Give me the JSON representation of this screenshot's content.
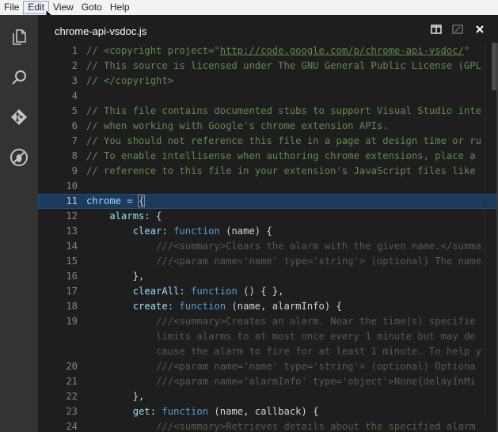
{
  "menu": [
    "File",
    "Edit",
    "View",
    "Goto",
    "Help"
  ],
  "tab": {
    "title": "chrome-api-vsdoc.js"
  },
  "activity": [
    "files-icon",
    "search-icon",
    "git-icon",
    "debug-icon"
  ],
  "titlebar_buttons": [
    "split-editor-icon",
    "open-changes-icon",
    "close-icon"
  ],
  "lines": [
    {
      "n": "1",
      "segments": [
        {
          "t": "// <copyright project=\"",
          "c": "comment"
        },
        {
          "t": "http://code.google.com/p/chrome-api-vsdoc/",
          "c": "comment link"
        },
        {
          "t": "\" ",
          "c": "comment"
        }
      ]
    },
    {
      "n": "2",
      "segments": [
        {
          "t": "// This source is licensed under The GNU General Public License (GPL",
          "c": "comment"
        }
      ]
    },
    {
      "n": "3",
      "segments": [
        {
          "t": "// </copyright>",
          "c": "comment"
        }
      ]
    },
    {
      "n": "4",
      "segments": []
    },
    {
      "n": "5",
      "segments": [
        {
          "t": "// This file contains documented stubs to support Visual Studio inte",
          "c": "comment"
        }
      ]
    },
    {
      "n": "6",
      "segments": [
        {
          "t": "// when working with Google's chrome extension APIs.",
          "c": "comment"
        }
      ]
    },
    {
      "n": "7",
      "segments": [
        {
          "t": "// You should not reference this file in a page at design time or ru",
          "c": "comment"
        }
      ]
    },
    {
      "n": "8",
      "segments": [
        {
          "t": "// To enable intellisense when authoring chrome extensions, place a ",
          "c": "comment"
        }
      ]
    },
    {
      "n": "9",
      "segments": [
        {
          "t": "// reference to this file in your extension's JavaScript files like",
          "c": "comment"
        }
      ]
    },
    {
      "n": "10",
      "segments": []
    },
    {
      "n": "11",
      "highlight": true,
      "segments": [
        {
          "t": "chrome = ",
          "c": "prop"
        },
        {
          "t": "{",
          "c": "bracket"
        }
      ]
    },
    {
      "n": "12",
      "segments": [
        {
          "t": "    alarms: {",
          "c": "prop"
        }
      ]
    },
    {
      "n": "13",
      "segments": [
        {
          "t": "        clear: ",
          "c": "prop"
        },
        {
          "t": "function",
          "c": "kw"
        },
        {
          "t": " (name) {",
          "c": ""
        }
      ]
    },
    {
      "n": "14",
      "segments": [
        {
          "t": "            ",
          "c": ""
        },
        {
          "t": "///<summary>Clears the alarm with the given name.</summa",
          "c": "comment-dim"
        }
      ]
    },
    {
      "n": "15",
      "segments": [
        {
          "t": "            ",
          "c": ""
        },
        {
          "t": "///<param name='name' type='string'> (optional) The name",
          "c": "comment-dim"
        }
      ]
    },
    {
      "n": "16",
      "segments": [
        {
          "t": "        },",
          "c": ""
        }
      ]
    },
    {
      "n": "17",
      "segments": [
        {
          "t": "        clearAll: ",
          "c": "prop"
        },
        {
          "t": "function",
          "c": "kw"
        },
        {
          "t": " () { },",
          "c": ""
        }
      ]
    },
    {
      "n": "18",
      "segments": [
        {
          "t": "        create: ",
          "c": "prop"
        },
        {
          "t": "function",
          "c": "kw"
        },
        {
          "t": " (name, alarmInfo) {",
          "c": ""
        }
      ]
    },
    {
      "n": "19",
      "segments": [
        {
          "t": "            ",
          "c": ""
        },
        {
          "t": "///<summary>Creates an alarm. Near the time(s) specifie",
          "c": "comment-dim"
        }
      ]
    },
    {
      "n": "",
      "segments": [
        {
          "t": "            ",
          "c": ""
        },
        {
          "t": "limits alarms to at most once every 1 minute but may de",
          "c": "comment-dim"
        }
      ]
    },
    {
      "n": "",
      "segments": [
        {
          "t": "            ",
          "c": ""
        },
        {
          "t": "cause the alarm to fire for at least 1 minute. To help y",
          "c": "comment-dim"
        }
      ]
    },
    {
      "n": "20",
      "segments": [
        {
          "t": "            ",
          "c": ""
        },
        {
          "t": "///<param name='name' type='string'> (optional) Optiona",
          "c": "comment-dim"
        }
      ]
    },
    {
      "n": "21",
      "segments": [
        {
          "t": "            ",
          "c": ""
        },
        {
          "t": "///<param name='alarmInfo' type='object'>None{delayInMi",
          "c": "comment-dim"
        }
      ]
    },
    {
      "n": "22",
      "segments": [
        {
          "t": "        },",
          "c": ""
        }
      ]
    },
    {
      "n": "23",
      "segments": [
        {
          "t": "        get: ",
          "c": "prop"
        },
        {
          "t": "function",
          "c": "kw"
        },
        {
          "t": " (name, callback) {",
          "c": ""
        }
      ]
    },
    {
      "n": "24",
      "segments": [
        {
          "t": "            ",
          "c": ""
        },
        {
          "t": "///<summary>Retrieves details about the specified alarm",
          "c": "comment-dim"
        }
      ]
    }
  ]
}
